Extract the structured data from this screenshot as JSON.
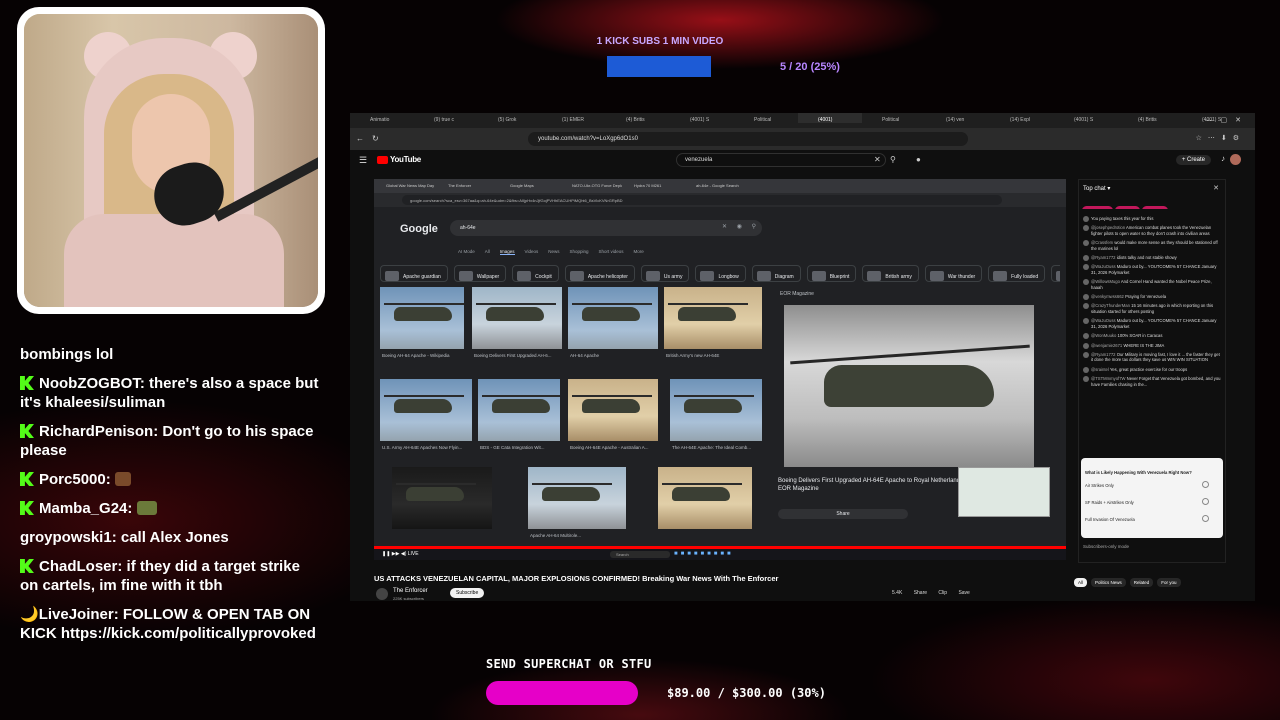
{
  "overlay": {
    "top_goal": {
      "title": "1 KICK SUBS 1 MIN VIDEO",
      "progress_text": "5 / 20 (25%)",
      "progress_fraction": 0.25
    },
    "bottom_goal": {
      "title": "SEND SUPERCHAT OR STFU",
      "progress_text": "$89.00 / $300.00 (30%)",
      "progress_fraction": 0.3
    }
  },
  "chat": [
    {
      "user": "",
      "text": "bombings lol",
      "badge": ""
    },
    {
      "user": "NoobZOGBOT",
      "text": " there's also a space but it's khaleesi/suliman",
      "badge": "kick"
    },
    {
      "user": "RichardPenison",
      "text": " Don't go to his space please",
      "badge": "kick"
    },
    {
      "user": "Porc5000",
      "text": " ",
      "badge": "kick",
      "emote": "emote"
    },
    {
      "user": "Mamba_G24",
      "text": " ",
      "badge": "kick-purple",
      "emote": "emote2"
    },
    {
      "user": "groypowski1",
      "text": " call Alex Jones",
      "badge": ""
    },
    {
      "user": "ChadLoser",
      "text": " if they did a target strike on cartels, im fine with it tbh",
      "badge": "kick"
    },
    {
      "user": "LiveJoiner",
      "text": " FOLLOW & OPEN TAB ON KICK https://kick.com/politicallyprovoked",
      "badge": "moon"
    }
  ],
  "browser": {
    "tabs": [
      "Animatio",
      "(9) true c",
      "(5) Grok",
      "(1) EMER",
      "(4) Britis",
      "(4001) S",
      "Political",
      "(4001)",
      "Political",
      "(14) ven",
      "(14) Expl",
      "(4001) S",
      "(4) Britis",
      "(4001) S",
      "FINAL S"
    ],
    "url": "youtube.com/watch?v=LoXgp6dO1s0"
  },
  "youtube": {
    "logo": "YouTube",
    "search": "venezuela",
    "create_label": "Create",
    "video_title": "US ATTACKS VENEZUELAN CAPITAL, MAJOR EXPLOSIONS CONFIRMED! Breaking War News With The Enforcer",
    "channel": "The Enforcer",
    "channel_subs": "225K subscribers",
    "subscribe": "Subscribe",
    "actions": [
      "5.4K",
      "Share",
      "Clip",
      "Save"
    ]
  },
  "inner_browser": {
    "tabs": [
      "Global War News Map Day",
      "The Enforcer",
      "Google Maps",
      "NATO-Ukr-OTG Force Deploy",
      "Hydra 70 M261",
      "ah-64e - Google Search"
    ],
    "url": "google.com/search?sca_esv=367aa&q=ah-64e&udm=2&fbs=AIIjpHx4nJjfGojPVHhEACUHPiMQht6_BsVlcKVNrGRpBD",
    "google_logo": "Google",
    "query": "ah-64e",
    "tabs_row": [
      "AI Mode",
      "All",
      "Images",
      "Videos",
      "News",
      "Shopping",
      "Short videos",
      "More"
    ],
    "chips": [
      "Apache guardian",
      "Wallpaper",
      "Cockpit",
      "Apache helicopter",
      "Us army",
      "Longbow",
      "Diagram",
      "Blueprint",
      "British army",
      "War thunder",
      "Fully loaded",
      "Silhouette"
    ],
    "results": [
      "Boeing AH-64 Apache - Wikipedia",
      "Boeing Delivers First Upgraded AH-6...",
      "AH-64 Apache",
      "British Army's new AH-64E",
      "U.S. Army AH-64E Apaches Now Flyin...",
      "BDS - GE Cata Integration Wit...",
      "Boeing AH-64E Apache - Australian A...",
      "The AH-64E Apache: The Ideal Comb...",
      "",
      "Apache AH-64 Multirole...",
      ""
    ],
    "detail": {
      "source": "EOR Magazine",
      "title": "Boeing Delivers First Upgraded AH-64E Apache to Royal Netherlands... - EOR Magazine",
      "share": "Share"
    }
  },
  "live_chat": {
    "header": "Top chat",
    "tickers": [
      "@bigod7971",
      "@sobrtac",
      "@illmutph"
    ],
    "messages": [
      {
        "user": "",
        "text": "You paying taxes this year for this"
      },
      {
        "user": "@josephpedrotion",
        "text": "American combat planes took the Venezuelan fighter pilots to open water so they don't crash into civilian areas"
      },
      {
        "user": "@Crassfem",
        "text": "would make more sense as they should be stationed off the marines lol"
      },
      {
        "user": "@Ryam1772",
        "text": "idiots talky and not stable showy"
      },
      {
        "user": "@WaJuOuss",
        "text": "Maduro out by... YOUTCOME% 57 CHANCE January 31, 2026 Polymarket"
      },
      {
        "user": "@WillowsMugo",
        "text": "And Cornel Hand wanted the Nobel Peace Prize, haaah"
      },
      {
        "user": "@venkymwss662",
        "text": "Praying for Venezuela"
      },
      {
        "user": "@CrazyThunderMan",
        "text": "15 16 minutes ago in which reporting on this situation started for others posting"
      },
      {
        "user": "@WaJuOuss",
        "text": "Maduro out by... YOUTCOME% 57 CHANCE January 31, 2026 Polymarket"
      },
      {
        "user": "@WonMuuko",
        "text": "100% SOAR in Caracas"
      },
      {
        "user": "@wenjamie2671",
        "text": "WHERE IS THE JIMA"
      },
      {
        "user": "@Ryam1772",
        "text": "Our Military is moving fast, I love it ... the faster they get it done the more tax dollars they save us WIN WIN SITUATION"
      },
      {
        "user": "@sraintel",
        "text": "Yes, great practice exercise for our troops"
      },
      {
        "user": "@TSTMmmyof7W",
        "text": "Never Forget that Venezuela got bombed, and you have Families chasing in the..."
      }
    ],
    "poll": {
      "question": "What is Likely Happening With Venezuela Right Now?",
      "options": [
        "Air Strikes Only",
        "SF Raids + Airstrikes Only",
        "Full Invasion Of Venezuela"
      ]
    },
    "input": "Subscribers-only mode",
    "filter_tabs": [
      "All",
      "Politics News",
      "Related",
      "For you"
    ]
  },
  "colors": {
    "kick_green": "#53fc18",
    "goal_top_bar": "#1d5bd6",
    "goal_bottom_bar": "#e600c8",
    "youtube_red": "#ff0000"
  }
}
